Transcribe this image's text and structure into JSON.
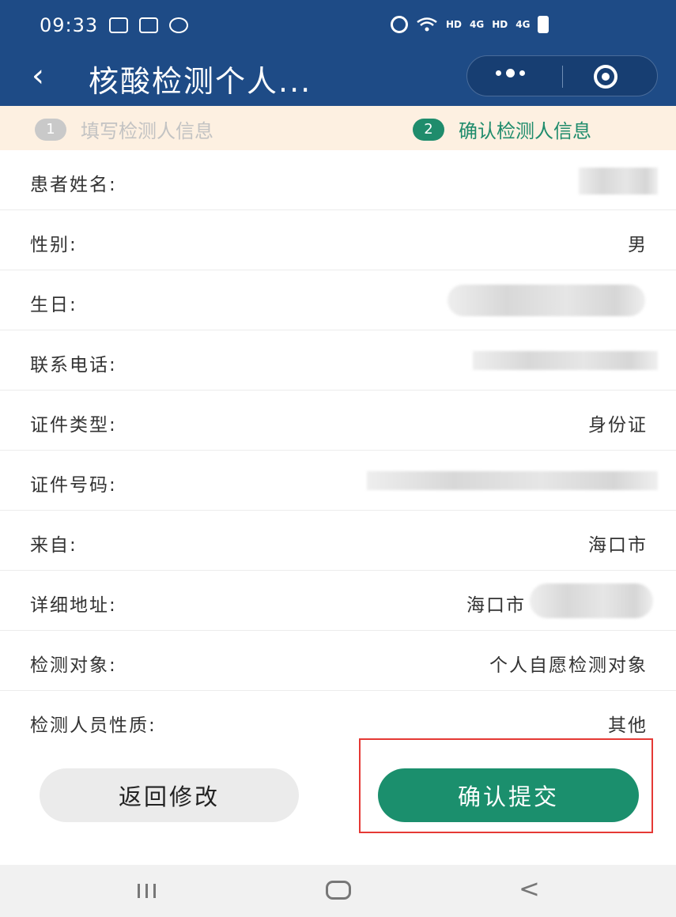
{
  "status_bar": {
    "time": "09:33",
    "net_label_1": "HD",
    "net_label_2": "HD",
    "signal_1": "4G",
    "signal_2": "4G"
  },
  "title_bar": {
    "back_icon": "‹",
    "title": "核酸检测个人..."
  },
  "steps": [
    {
      "number": "1",
      "label": "填写检测人信息"
    },
    {
      "number": "2",
      "label": "确认检测人信息"
    }
  ],
  "fields": {
    "name": {
      "label": "患者姓名:"
    },
    "gender": {
      "label": "性别:",
      "value": "男"
    },
    "birthday": {
      "label": "生日:"
    },
    "phone": {
      "label": "联系电话:"
    },
    "id_type": {
      "label": "证件类型:",
      "value": "身份证"
    },
    "id_number": {
      "label": "证件号码:"
    },
    "from": {
      "label": "来自:",
      "value": "海口市"
    },
    "address": {
      "label": "详细地址:",
      "value": "海口市"
    },
    "target": {
      "label": "检测对象:",
      "value": "个人自愿检测对象"
    },
    "nature": {
      "label": "检测人员性质:",
      "value": "其他"
    }
  },
  "actions": {
    "back_label": "返回修改",
    "confirm_label": "确认提交"
  },
  "colors": {
    "header_bg": "#1e4b86",
    "accent_green": "#1b8f6d",
    "highlight_red": "#e53935"
  }
}
